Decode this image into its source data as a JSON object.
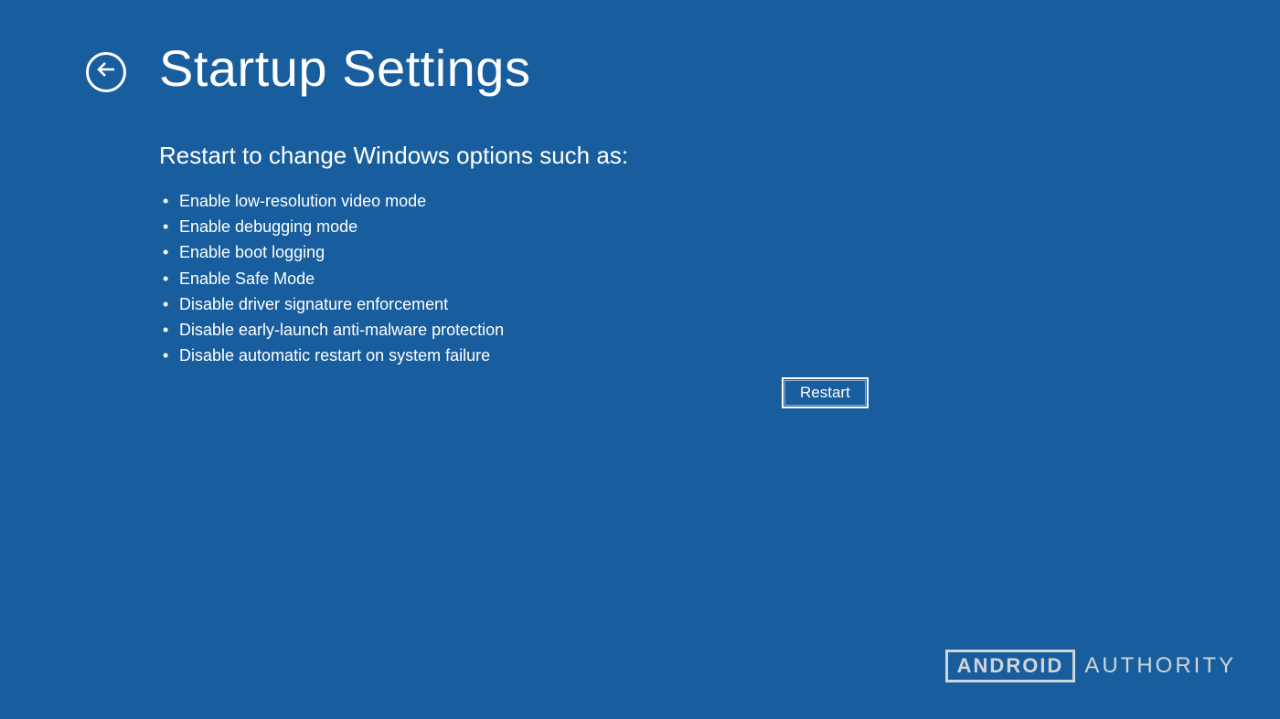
{
  "header": {
    "title": "Startup Settings"
  },
  "content": {
    "subtitle": "Restart to change Windows options such as:",
    "options": [
      "Enable low-resolution video mode",
      "Enable debugging mode",
      "Enable boot logging",
      "Enable Safe Mode",
      "Disable driver signature enforcement",
      "Disable early-launch anti-malware protection",
      "Disable automatic restart on system failure"
    ]
  },
  "actions": {
    "restart_label": "Restart"
  },
  "watermark": {
    "boxed": "ANDROID",
    "plain": "AUTHORITY"
  }
}
